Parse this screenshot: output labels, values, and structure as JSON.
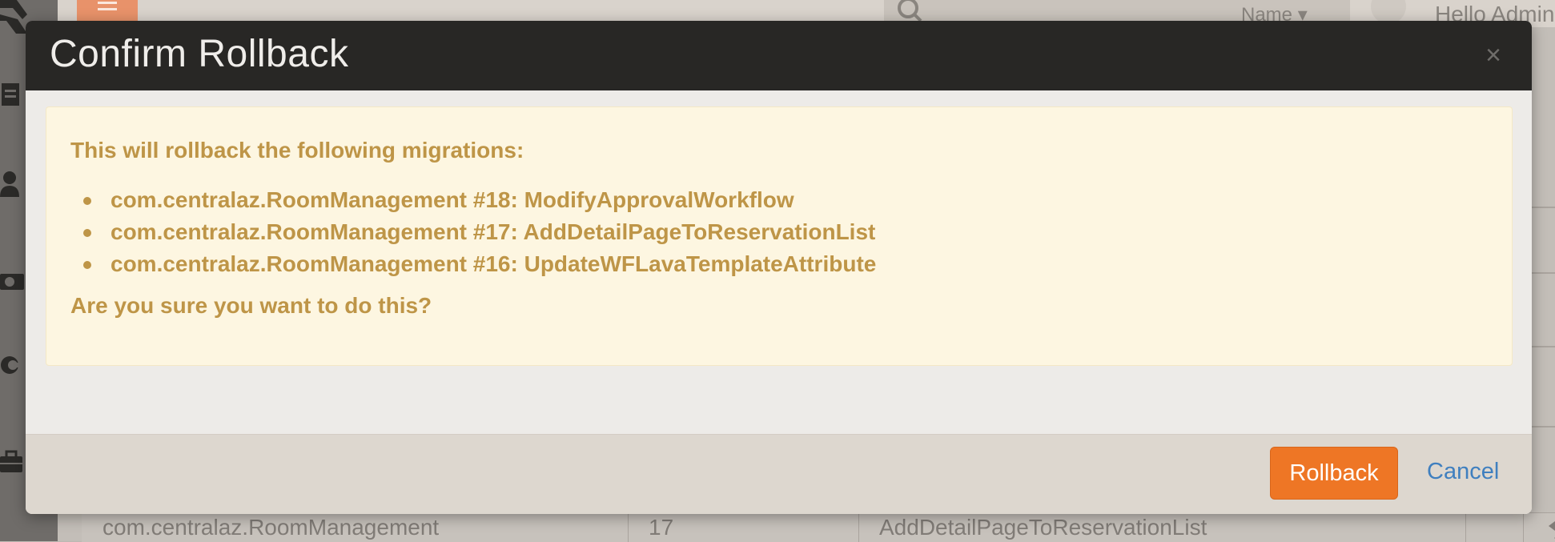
{
  "background": {
    "header": {
      "search_scope": "Name ▾",
      "user_greeting": "Hello Admin"
    },
    "table_row": {
      "plugin": "com.centralaz.RoomManagement",
      "number": "17",
      "migration": "AddDetailPageToReservationList"
    }
  },
  "modal": {
    "title": "Confirm Rollback",
    "close_label": "×",
    "warning": {
      "intro": "This will rollback the following migrations:",
      "migrations": [
        "com.centralaz.RoomManagement #18: ModifyApprovalWorkflow",
        "com.centralaz.RoomManagement #17: AddDetailPageToReservationList",
        "com.centralaz.RoomManagement #16: UpdateWFLavaTemplateAttribute"
      ],
      "question": "Are you sure you want to do this?"
    },
    "footer": {
      "rollback_label": "Rollback",
      "cancel_label": "Cancel"
    }
  },
  "colors": {
    "accent": "#ee7625",
    "warning_text": "#be9547",
    "warning_background": "#fdf6e1",
    "modal_header": "#282725",
    "link": "#3f7fbf"
  }
}
